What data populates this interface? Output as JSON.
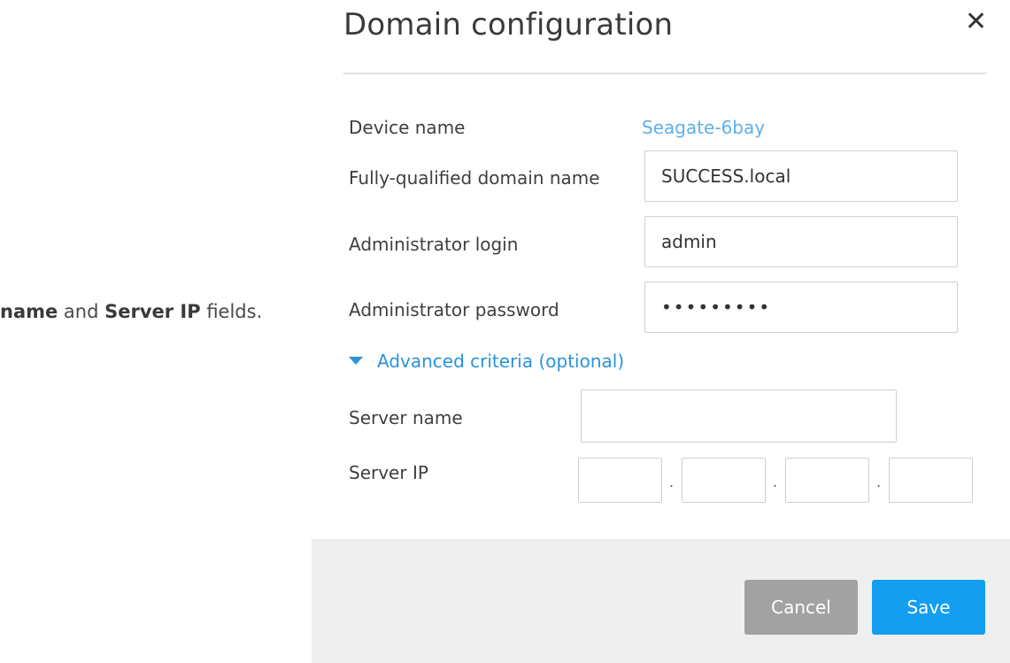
{
  "side_note": {
    "part1": "name",
    "part2": " and ",
    "part3": "Server IP",
    "part4": " fields."
  },
  "dialog": {
    "title": "Domain configuration",
    "close_glyph": "✕",
    "device_name_label": "Device name",
    "device_name_value": "Seagate-6bay",
    "fqdn_label": "Fully-qualified domain name",
    "fqdn_value": "SUCCESS.local",
    "admin_login_label": "Administrator login",
    "admin_login_value": "admin",
    "admin_password_label": "Administrator password",
    "admin_password_value": "•••••••••",
    "advanced_label": "Advanced criteria (optional)",
    "server_name_label": "Server name",
    "server_name_value": "",
    "server_ip_label": "Server IP",
    "server_ip_octets": [
      "",
      "",
      "",
      ""
    ],
    "ip_separator": "."
  },
  "footer": {
    "cancel_label": "Cancel",
    "save_label": "Save"
  },
  "colors": {
    "accent": "#139ef0",
    "link": "#2a93dc",
    "device_value": "#5db0e8",
    "cancel_bg": "#a2a2a2",
    "footer_bg": "#efefef"
  },
  "icons": {
    "close": "close-icon",
    "advanced_toggle": "triangle-down-icon"
  }
}
